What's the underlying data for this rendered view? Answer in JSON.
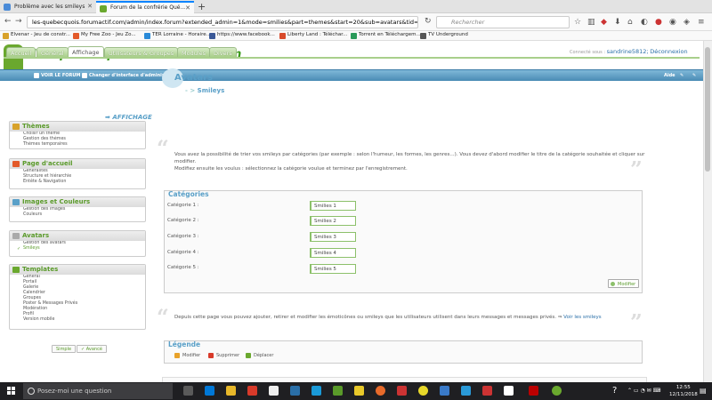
{
  "browser": {
    "tabs": [
      {
        "label": "Problème avec les smileys",
        "active": false
      },
      {
        "label": "Forum de la confrérie Qué...",
        "active": true
      }
    ],
    "url": "les-quebecquois.forumactif.com/admin/index.forum?extended_admin=1&mode=smilies&part=themes&start=20&sub=avatars&tid=9764c",
    "search_placeholder": "Rechercher",
    "bookmarks": [
      "Elvenar - Jeu de constr...",
      "My Free Zoo - Jeu Zo...",
      "TER Lorraine - Horaire...",
      "https://www.facebook...",
      "Liberty Land : Téléchar...",
      "Torrent en Téléchargem...",
      "TV Underground"
    ]
  },
  "site": {
    "name": "les-quebecquois.forumactif.com",
    "connected_label": "Connecté sous :",
    "user": "sandrine5812",
    "logout": "Déconnexion",
    "top_links": [
      "VOIR LE FORUM",
      "Changer d'interface d'administration"
    ],
    "aide": "Aide"
  },
  "admin_tabs": [
    "Accueil",
    "Général",
    "Affichage",
    "Utilisateurs & Groupes",
    "Modules",
    "Divers"
  ],
  "sidebar": {
    "header": "AFFICHAGE",
    "sections": [
      {
        "title": "Thèmes",
        "items": [
          "Choisir un thème",
          "Gestion des thèmes",
          "Thèmes temporaires"
        ]
      },
      {
        "title": "Page d'accueil",
        "items": [
          "Généralités",
          "Structure et hiérarchie",
          "Entête & Navigation"
        ]
      },
      {
        "title": "Images et Couleurs",
        "items": [
          "Gestion des images",
          "Couleurs"
        ]
      },
      {
        "title": "Avatars",
        "items": [
          "Gestion des avatars",
          "Smileys"
        ]
      },
      {
        "title": "Templates",
        "items": [
          "Général",
          "Portail",
          "Galerie",
          "Calendrier",
          "Groupes",
          "Poster & Messages Privés",
          "Modération",
          "Profil",
          "Version mobile"
        ]
      }
    ],
    "btn_simple": "Simple",
    "btn_avance": "Avancé"
  },
  "main": {
    "title": "Avatars",
    "subtitle": "Smileys",
    "desc1": "Vous avez la possibilité de trier vos smileys par catégories (par exemple : selon l'humeur, les formes, les genres...). Vous devez d'abord modifier le titre de la catégorie souhaitée et cliquer sur modifier.",
    "desc2": "Modifiez ensuite les voulus : sélectionnez la catégorie voulue et terminez par l'enregistrement.",
    "categories_legend": "Catégories",
    "categories": [
      {
        "label": "Catégorie 1 :",
        "value": "Smilies 1"
      },
      {
        "label": "Catégorie 2 :",
        "value": "Smilies 2"
      },
      {
        "label": "Catégorie 3 :",
        "value": "Smilies 3"
      },
      {
        "label": "Catégorie 4 :",
        "value": "Smilies 4"
      },
      {
        "label": "Catégorie 5 :",
        "value": "Smilies 5"
      }
    ],
    "modifier": "Modifier",
    "emoticons_text": "Depuis cette page vous pouvez ajouter, retirer et modifier les émoticônes ou smileys que les utilisateurs utilisent dans leurs messages et messages privés.",
    "voir_link": "Voir les smileys",
    "legende": "Légende",
    "legend_items": [
      "Modifier",
      "Supprimer",
      "Déplacer"
    ]
  },
  "taskbar": {
    "search": "Posez-moi une question",
    "time": "12:55",
    "date": "12/11/2018"
  }
}
